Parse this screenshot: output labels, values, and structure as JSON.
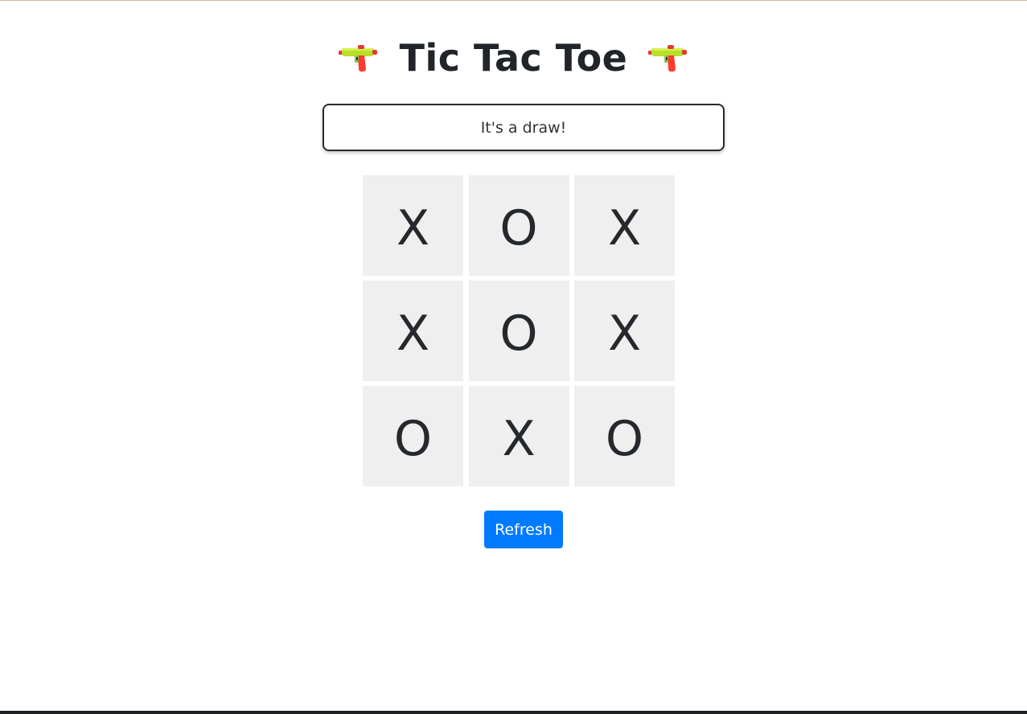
{
  "header": {
    "title": "Tic Tac Toe",
    "left_icon": "water-pistol-icon",
    "right_icon": "water-pistol-icon"
  },
  "status": {
    "text": "It's a draw!"
  },
  "board": {
    "cells": [
      "X",
      "O",
      "X",
      "X",
      "O",
      "X",
      "O",
      "X",
      "O"
    ]
  },
  "controls": {
    "refresh_label": "Refresh"
  },
  "colors": {
    "accent": "#007bff",
    "cell_background": "#efefef",
    "text": "#212529"
  }
}
